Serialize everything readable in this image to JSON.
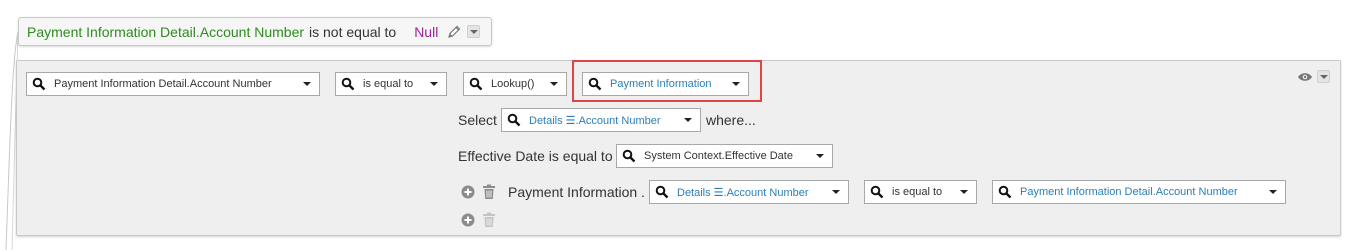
{
  "summary_rule": {
    "field": "Payment Information Detail.Account Number",
    "operator": "is not equal to",
    "value": "Null"
  },
  "condition_row": {
    "field_select": "Payment Information Detail.Account Number",
    "operator_select": "is equal to",
    "function_select": "Lookup()",
    "entity_select": "Payment Information"
  },
  "select_row": {
    "label_select": "Select",
    "column_select": "Details ☰.Account Number",
    "label_where": "where..."
  },
  "effective_row": {
    "label": "Effective Date is equal to",
    "value_select": "System Context.Effective Date"
  },
  "criteria_row": {
    "prefix_label": "Payment Information .",
    "left_select": "Details ☰.Account Number",
    "operator_select": "is equal to",
    "right_select": "Payment Information Detail.Account Number"
  },
  "icons": {
    "search": "magnifier-icon",
    "edit": "pencil-icon",
    "add": "plus-circle-icon",
    "delete": "trash-icon",
    "visibility": "eye-icon",
    "dropdown": "triangle-down-icon"
  },
  "colors": {
    "field_green": "#2e8b1e",
    "value_purple": "#9b1f9b",
    "link_blue": "#2a7fb8",
    "highlight_red": "#e04444"
  }
}
